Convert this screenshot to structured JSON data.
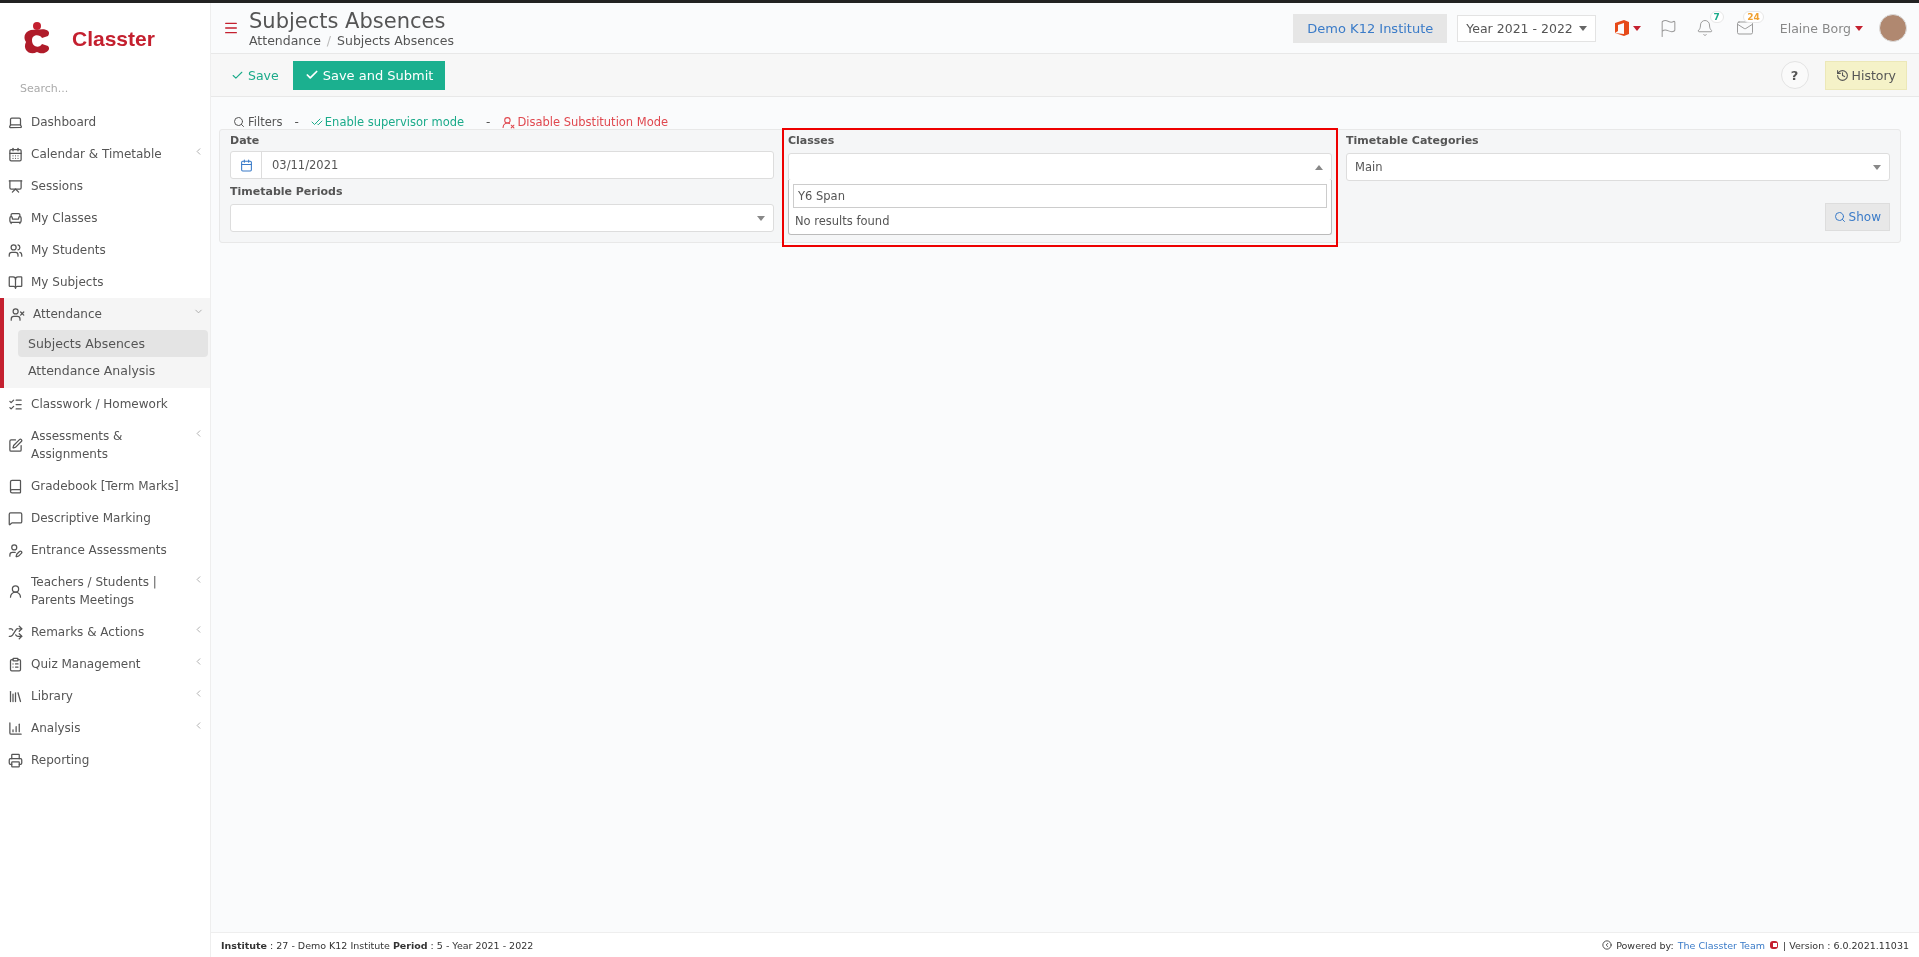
{
  "brand": {
    "name": "Classter"
  },
  "sidebar": {
    "search_placeholder": "Search...",
    "items": [
      {
        "label": "Dashboard",
        "has_submenu": false,
        "expanded": false
      },
      {
        "label": "Calendar & Timetable",
        "has_submenu": true,
        "expanded": false
      },
      {
        "label": "Sessions",
        "has_submenu": false,
        "expanded": false
      },
      {
        "label": "My Classes",
        "has_submenu": false,
        "expanded": false
      },
      {
        "label": "My Students",
        "has_submenu": false,
        "expanded": false
      },
      {
        "label": "My Subjects",
        "has_submenu": false,
        "expanded": false
      },
      {
        "label": "Attendance",
        "has_submenu": true,
        "expanded": true,
        "children": [
          {
            "label": "Subjects Absences",
            "selected": true
          },
          {
            "label": "Attendance Analysis",
            "selected": false
          }
        ]
      },
      {
        "label": "Classwork / Homework",
        "has_submenu": false,
        "expanded": false
      },
      {
        "label": "Assessments & Assignments",
        "has_submenu": true,
        "expanded": false
      },
      {
        "label": "Gradebook [Term Marks]",
        "has_submenu": false,
        "expanded": false
      },
      {
        "label": "Descriptive Marking",
        "has_submenu": false,
        "expanded": false
      },
      {
        "label": "Entrance Assessments",
        "has_submenu": false,
        "expanded": false
      },
      {
        "label": "Teachers / Students | Parents Meetings",
        "has_submenu": true,
        "expanded": false
      },
      {
        "label": "Remarks & Actions",
        "has_submenu": true,
        "expanded": false
      },
      {
        "label": "Quiz Management",
        "has_submenu": true,
        "expanded": false
      },
      {
        "label": "Library",
        "has_submenu": true,
        "expanded": false
      },
      {
        "label": "Analysis",
        "has_submenu": true,
        "expanded": false
      },
      {
        "label": "Reporting",
        "has_submenu": false,
        "expanded": false
      }
    ]
  },
  "header": {
    "title": "Subjects Absences",
    "breadcrumb": [
      "Attendance",
      "Subjects Absences"
    ],
    "breadcrumb_separator": "/",
    "institute": "Demo K12 Institute",
    "year": "Year 2021 - 2022",
    "notifications": "7",
    "messages": "24",
    "user": "Elaine Borg"
  },
  "toolbar": {
    "save": "Save",
    "save_submit": "Save and Submit",
    "help": "?",
    "history": "History"
  },
  "filters": {
    "label": "Filters",
    "links": [
      {
        "separator": "-",
        "label": "Enable supervisor mode",
        "kind": "enable"
      },
      {
        "separator": "-",
        "label": "Disable Substitution Mode",
        "kind": "disable"
      }
    ],
    "date": {
      "label": "Date",
      "value": "03/11/2021"
    },
    "periods": {
      "label": "Timetable Periods"
    },
    "classes": {
      "label": "Classes",
      "open": true,
      "search": "Y6 Span",
      "message": "No results found"
    },
    "categories": {
      "label": "Timetable Categories",
      "value": "Main"
    },
    "show": "Show"
  },
  "footer": {
    "info": "**Institute** : 27 - Demo K12 Institute **Period** : 5 - Year 2021 - 2022",
    "powered": "Powered by:",
    "team": "The Classter Team",
    "version": "| Version : 6.0.2021.11031"
  }
}
